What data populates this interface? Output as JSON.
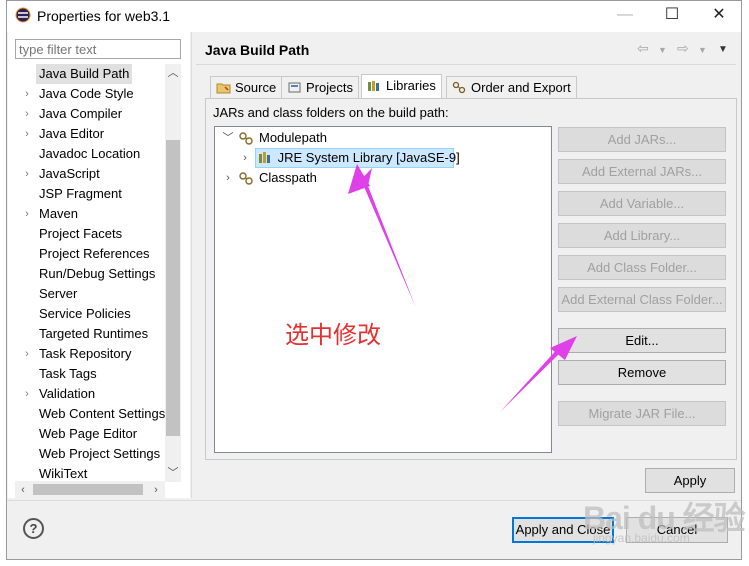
{
  "window": {
    "title": "Properties for web3.1",
    "controls": {
      "minimize": "—",
      "maximize": "☐",
      "close": "✕"
    }
  },
  "left": {
    "filter_placeholder": "type filter text",
    "items": [
      {
        "label": "Java Build Path",
        "expandable": false,
        "selected": true
      },
      {
        "label": "Java Code Style",
        "expandable": true
      },
      {
        "label": "Java Compiler",
        "expandable": true
      },
      {
        "label": "Java Editor",
        "expandable": true
      },
      {
        "label": "Javadoc Location",
        "expandable": false
      },
      {
        "label": "JavaScript",
        "expandable": true
      },
      {
        "label": "JSP Fragment",
        "expandable": false
      },
      {
        "label": "Maven",
        "expandable": true
      },
      {
        "label": "Project Facets",
        "expandable": false
      },
      {
        "label": "Project References",
        "expandable": false
      },
      {
        "label": "Run/Debug Settings",
        "expandable": false
      },
      {
        "label": "Server",
        "expandable": false
      },
      {
        "label": "Service Policies",
        "expandable": false
      },
      {
        "label": "Targeted Runtimes",
        "expandable": false
      },
      {
        "label": "Task Repository",
        "expandable": true
      },
      {
        "label": "Task Tags",
        "expandable": false
      },
      {
        "label": "Validation",
        "expandable": true
      },
      {
        "label": "Web Content Settings",
        "expandable": false
      },
      {
        "label": "Web Page Editor",
        "expandable": false
      },
      {
        "label": "Web Project Settings",
        "expandable": false
      },
      {
        "label": "WikiText",
        "expandable": false
      }
    ]
  },
  "right": {
    "title": "Java Build Path",
    "tabs": [
      {
        "label": "Source"
      },
      {
        "label": "Projects"
      },
      {
        "label": "Libraries",
        "active": true
      },
      {
        "label": "Order and Export"
      }
    ],
    "panel_label": "JARs and class folders on the build path:",
    "tree": [
      {
        "label": "Modulepath",
        "expanded": true
      },
      {
        "label": "JRE System Library [JavaSE-9]",
        "selected": true
      },
      {
        "label": "Classpath",
        "expanded": false
      }
    ],
    "buttons": [
      {
        "label": "Add JARs...",
        "enabled": false
      },
      {
        "label": "Add External JARs...",
        "enabled": false
      },
      {
        "label": "Add Variable...",
        "enabled": false
      },
      {
        "label": "Add Library...",
        "enabled": false
      },
      {
        "label": "Add Class Folder...",
        "enabled": false
      },
      {
        "label": "Add External Class Folder...",
        "enabled": false
      },
      {
        "label": "Edit...",
        "enabled": true
      },
      {
        "label": "Remove",
        "enabled": true
      },
      {
        "label": "Migrate JAR File...",
        "enabled": false
      }
    ],
    "apply": "Apply"
  },
  "footer": {
    "help": "?",
    "apply_close": "Apply and Close",
    "cancel": "Cancel"
  },
  "annotation": {
    "text": "选中修改",
    "color": "#e53030",
    "arrow_color": "#e040e8"
  },
  "watermark": {
    "brand": "Bai du 经验",
    "sub": "jingyan.baidu.com"
  }
}
